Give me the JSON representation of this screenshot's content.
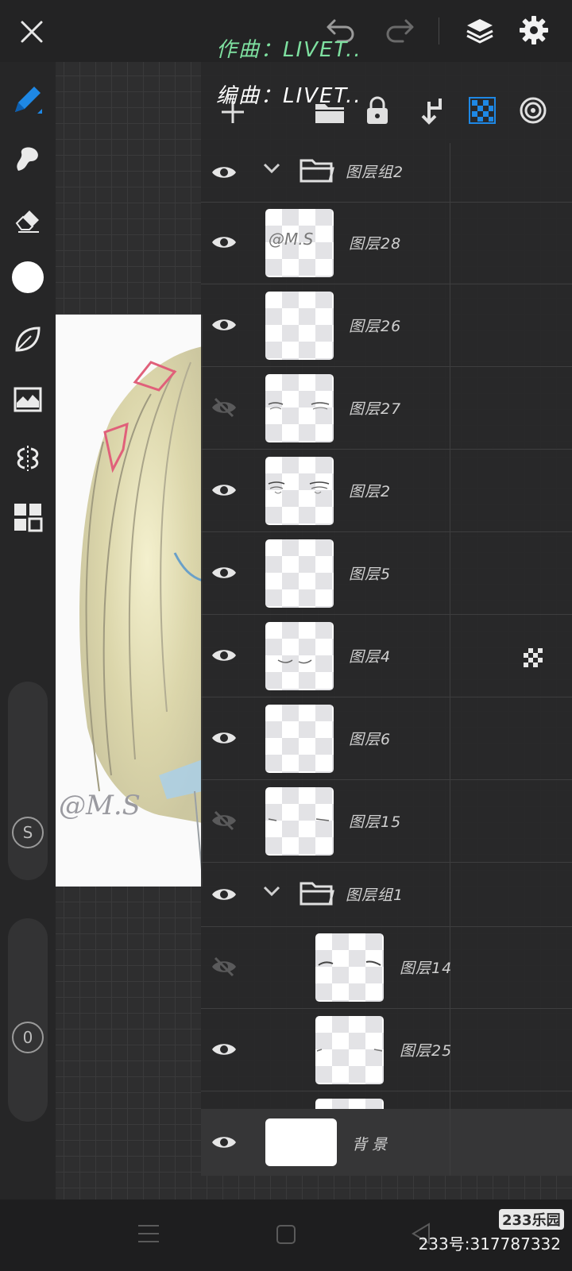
{
  "header": {
    "credit_composer": "作曲：LIVET..",
    "credit_arranger": "编曲：LIVET.."
  },
  "left_tools": {
    "slider_size_label": "S",
    "slider_opacity_label": "0"
  },
  "canvas": {
    "signature_text": "@M.S"
  },
  "layers": {
    "group2": {
      "name": "图层组2"
    },
    "items_group2": [
      {
        "name": "图层28",
        "visible": true,
        "thumb_text": "@M.S"
      },
      {
        "name": "图层26",
        "visible": true
      },
      {
        "name": "图层27",
        "visible": false
      },
      {
        "name": "图层2",
        "visible": true
      },
      {
        "name": "图层5",
        "visible": true
      },
      {
        "name": "图层4",
        "visible": true,
        "alpha_locked": true
      },
      {
        "name": "图层6",
        "visible": true
      },
      {
        "name": "图层15",
        "visible": false
      }
    ],
    "group1": {
      "name": "图层组1"
    },
    "items_group1": [
      {
        "name": "图层14",
        "visible": false
      },
      {
        "name": "图层25",
        "visible": true
      }
    ],
    "background": {
      "name": "背景",
      "visible": true
    }
  },
  "watermark": {
    "brand": "233乐园",
    "id_text": "233号:317787332"
  },
  "colors": {
    "accent": "#1e88e5",
    "credit_green": "#7ee0a0",
    "canvas_bg": "#fafafa"
  }
}
